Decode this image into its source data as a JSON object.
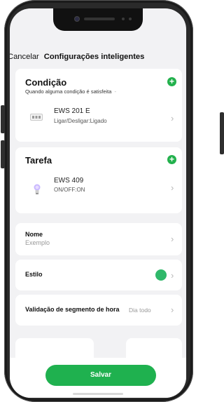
{
  "header": {
    "cancel_label": "Cancelar",
    "title": "Configurações inteligentes"
  },
  "condition": {
    "title": "Condição",
    "subtitle": "Quando alguma condição é satisfeita",
    "subtitle_chevron": "-",
    "add_icon": "plus-circle-icon",
    "device": {
      "name": "EWS 201 E",
      "state": "Ligar/Desligar:Ligado",
      "icon": "switch-device-icon"
    }
  },
  "task": {
    "title": "Tarefa",
    "add_icon": "plus-circle-icon",
    "device": {
      "name": "EWS 409",
      "state": "ON/OFF:ON",
      "icon": "bulb-icon"
    }
  },
  "name_row": {
    "label": "Nome",
    "value": "Exemplo"
  },
  "style_row": {
    "label": "Estilo",
    "color": "#2fb86a"
  },
  "time_row": {
    "label": "Validação de segmento de hora",
    "value": "Dia todo"
  },
  "footer": {
    "save_label": "Salvar"
  },
  "colors": {
    "accent": "#1fb14f",
    "background": "#f2f2f4"
  }
}
